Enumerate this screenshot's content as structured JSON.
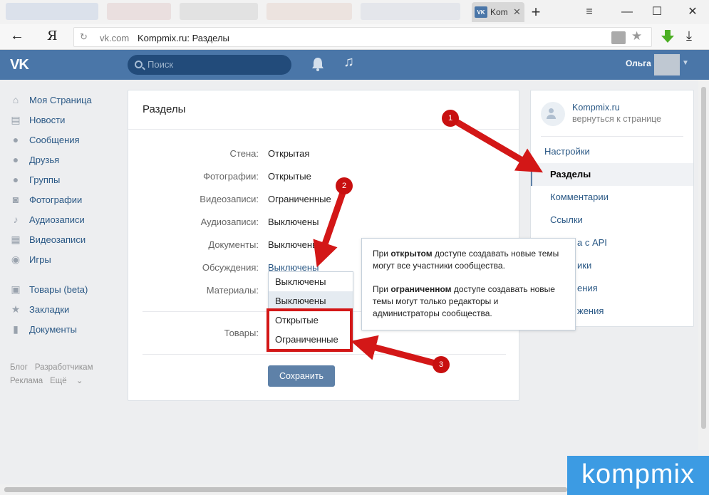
{
  "browser": {
    "tab_title": "Komp",
    "favicon_text": "VK",
    "url_domain": "vk.com",
    "url_title": "Kompmix.ru: Разделы",
    "ya_label": "Я"
  },
  "header": {
    "logo": "VK",
    "search_placeholder": "Поиск",
    "user_name": "Ольга"
  },
  "left_menu": {
    "items": [
      {
        "label": "Моя Страница",
        "icon": "home-icon"
      },
      {
        "label": "Новости",
        "icon": "news-icon"
      },
      {
        "label": "Сообщения",
        "icon": "messages-icon"
      },
      {
        "label": "Друзья",
        "icon": "friends-icon"
      },
      {
        "label": "Группы",
        "icon": "groups-icon"
      },
      {
        "label": "Фотографии",
        "icon": "photos-icon"
      },
      {
        "label": "Аудиозаписи",
        "icon": "music-icon"
      },
      {
        "label": "Видеозаписи",
        "icon": "video-icon"
      },
      {
        "label": "Игры",
        "icon": "games-icon"
      }
    ],
    "items2": [
      {
        "label": "Товары (beta)",
        "icon": "market-icon"
      },
      {
        "label": "Закладки",
        "icon": "bookmarks-icon"
      },
      {
        "label": "Документы",
        "icon": "documents-icon"
      }
    ],
    "footer": [
      "Блог",
      "Разработчикам",
      "Реклама",
      "Ещё"
    ]
  },
  "sections_card": {
    "title": "Разделы",
    "rows": [
      {
        "label": "Стена:",
        "value": "Открытая"
      },
      {
        "label": "Фотографии:",
        "value": "Открытые"
      },
      {
        "label": "Видеозаписи:",
        "value": "Ограниченные"
      },
      {
        "label": "Аудиозаписи:",
        "value": "Выключены"
      },
      {
        "label": "Документы:",
        "value": "Выключены"
      },
      {
        "label": "Обсуждения:",
        "value": "Выключены"
      },
      {
        "label": "Материалы:",
        "value": ""
      }
    ],
    "goods_label": "Товары:",
    "save_button": "Сохранить"
  },
  "dropdown": {
    "header_value": "Выключены",
    "options": [
      "Выключены",
      "Открытые",
      "Ограниченные"
    ]
  },
  "tooltip": {
    "p1_pre": "При ",
    "p1_bold": "открытом",
    "p1_post": " доступе создавать новые темы могут все участники сообщества.",
    "p2_pre": "При ",
    "p2_bold": "ограниченном",
    "p2_post": " доступе создавать новые темы могут только редакторы и администраторы сообщества."
  },
  "right_menu": {
    "group_name": "Kompmix.ru",
    "back_label": "вернуться к странице",
    "settings": "Настройки",
    "items": [
      "Разделы",
      "Комментарии",
      "Ссылки",
      "а с API",
      "ики",
      "ения",
      "жения"
    ]
  },
  "annotations": {
    "markers": [
      "1",
      "2",
      "3"
    ],
    "arrow_color": "#d31717"
  },
  "watermark": "kompmix"
}
